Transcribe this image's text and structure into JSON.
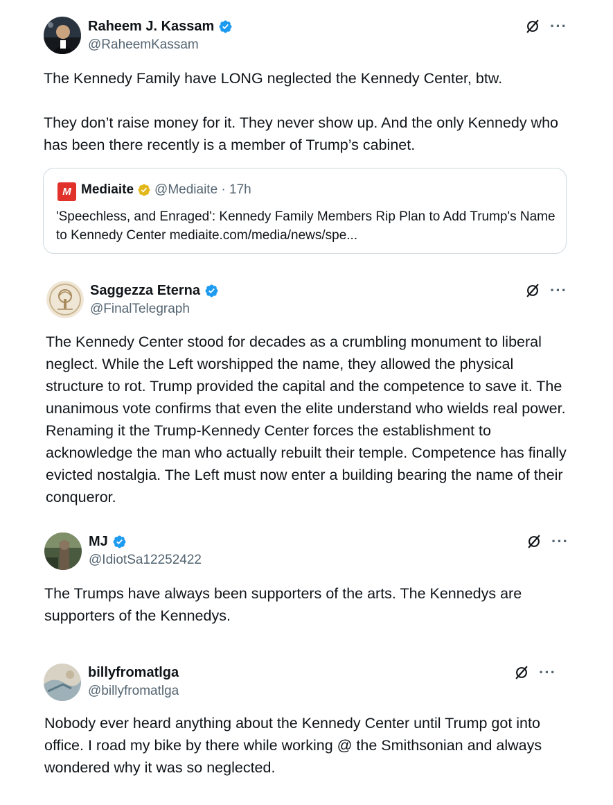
{
  "colors": {
    "text": "#0f1419",
    "secondary": "#536471",
    "verified_blue": "#1d9bf0",
    "verified_gold": "#e2b719",
    "border": "#cfd9de",
    "mediaite_red": "#e0312b"
  },
  "posts": [
    {
      "author": "Raheem J. Kassam",
      "handle": "@RaheemKassam",
      "verified": "blue",
      "text": "The Kennedy Family have LONG neglected the Kennedy Center, btw.\n\nThey don’t raise money for it. They never show up. And the only Kennedy who has been there recently is a member of Trump’s cabinet.",
      "quote": {
        "logo_letter": "M",
        "author": "Mediaite",
        "verified": "gold",
        "meta": "@Mediaite · 17h",
        "text": "'Speechless, and Enraged': Kennedy Family Members Rip Plan to Add Trump's Name to Kennedy Center  mediaite.com/media/news/spe..."
      }
    },
    {
      "author": "Saggezza Eterna",
      "handle": "@FinalTelegraph",
      "verified": "blue",
      "text": "The Kennedy Center stood for decades as a crumbling monument to liberal neglect. While the Left worshipped the name, they allowed the physical structure to rot. Trump provided the capital and the competence to save it. The unanimous vote confirms that even the elite understand who wields real power. Renaming it the Trump-Kennedy Center forces the establishment to acknowledge the man who actually rebuilt their temple. Competence has finally evicted nostalgia. The Left must now enter a building bearing the name of their conqueror."
    },
    {
      "author": "MJ",
      "handle": "@IdiotSa12252422",
      "verified": "blue",
      "text": "The Trumps have always been supporters of the arts. The Kennedys are supporters of the Kennedys."
    },
    {
      "author": "billyfromatlga",
      "handle": "@billyfromatlga",
      "verified": "none",
      "text": "Nobody ever heard anything about the Kennedy Center until Trump got into office.  I road my bike by there while working @ the Smithsonian and always wondered why it was so neglected."
    }
  ],
  "more_label": "···"
}
